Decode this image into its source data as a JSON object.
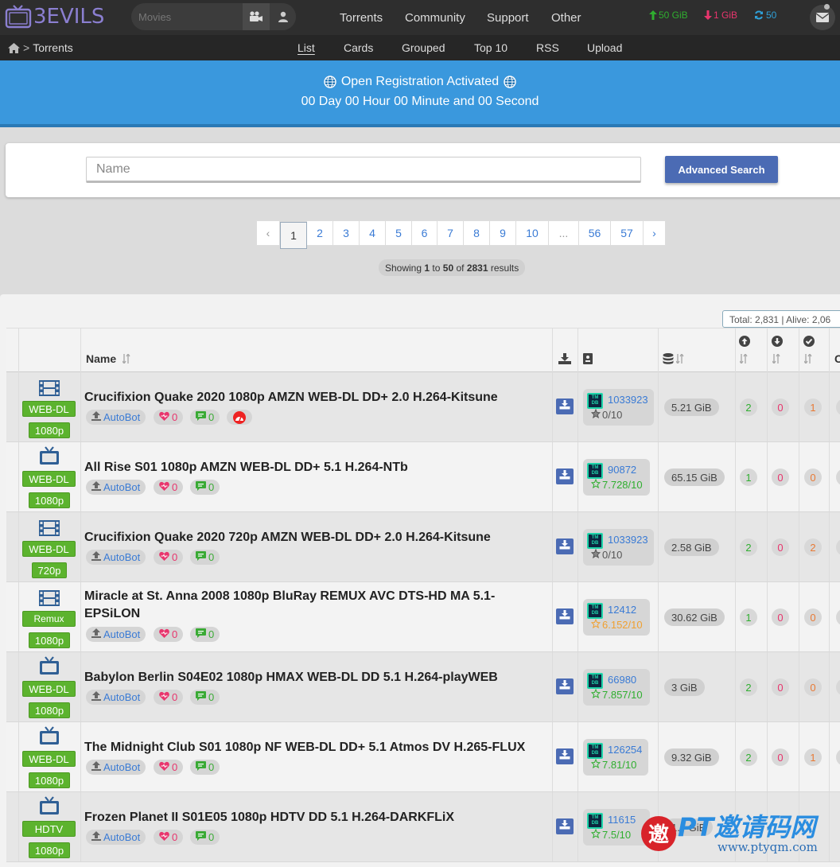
{
  "site": {
    "logo_text": "3EVILS"
  },
  "header": {
    "search_placeholder": "Movies",
    "nav": [
      "Torrents",
      "Community",
      "Support",
      "Other"
    ],
    "upload_stat": "50 GiB",
    "download_stat": "1 GiB",
    "ratio_stat": "50"
  },
  "subnav": {
    "breadcrumb": "Torrents",
    "items": [
      "List",
      "Cards",
      "Grouped",
      "Top 10",
      "RSS",
      "Upload"
    ],
    "active": "List"
  },
  "banner": {
    "line1": "Open Registration Activated",
    "line2": "00 Day 00 Hour 00 Minute and 00 Second"
  },
  "search": {
    "name_placeholder": "Name",
    "advanced_label": "Advanced Search"
  },
  "pagination": {
    "prev": "‹",
    "next": "›",
    "pages": [
      "1",
      "2",
      "3",
      "4",
      "5",
      "6",
      "7",
      "8",
      "9",
      "10",
      "...",
      "56",
      "57"
    ],
    "current": "1",
    "showing_prefix": "Showing",
    "from": "1",
    "to_word": "to",
    "to": "50",
    "of_word": "of",
    "total": "2831",
    "suffix": "results"
  },
  "summary": {
    "text": "Total: 2,831 | Alive: 2,06"
  },
  "table": {
    "name_header": "Name",
    "last_header": "C",
    "rows": [
      {
        "cat": "film",
        "type": "WEB-DL",
        "res": "1080p",
        "name": "Crucifixion Quake 2020 1080p AMZN WEB-DL DD+ 2.0 H.264-Kitsune",
        "uploader": "AutoBot",
        "thanks": "0",
        "comments": "0",
        "hot": true,
        "tmdb": "1033923",
        "rating": "0/10",
        "rating_color": "#555555",
        "size": "5.21 GiB",
        "seed": "2",
        "leech": "0",
        "done": "1"
      },
      {
        "cat": "tv",
        "type": "WEB-DL",
        "res": "1080p",
        "name": "All Rise S01 1080p AMZN WEB-DL DD+ 5.1 H.264-NTb",
        "uploader": "AutoBot",
        "thanks": "0",
        "comments": "0",
        "hot": false,
        "tmdb": "90872",
        "rating": "7.728/10",
        "rating_color": "#2fae2f",
        "size": "65.15 GiB",
        "seed": "1",
        "leech": "0",
        "done": "0"
      },
      {
        "cat": "film",
        "type": "WEB-DL",
        "res": "720p",
        "name": "Crucifixion Quake 2020 720p AMZN WEB-DL DD+ 2.0 H.264-Kitsune",
        "uploader": "AutoBot",
        "thanks": "0",
        "comments": "0",
        "hot": false,
        "tmdb": "1033923",
        "rating": "0/10",
        "rating_color": "#555555",
        "size": "2.58 GiB",
        "seed": "2",
        "leech": "0",
        "done": "2"
      },
      {
        "cat": "film",
        "type": "Remux",
        "res": "1080p",
        "name": "Miracle at St. Anna 2008 1080p BluRay REMUX AVC DTS-HD MA 5.1-EPSiLON",
        "uploader": "AutoBot",
        "thanks": "0",
        "comments": "0",
        "hot": false,
        "tmdb": "12412",
        "rating": "6.152/10",
        "rating_color": "#f0a030",
        "size": "30.62 GiB",
        "seed": "1",
        "leech": "0",
        "done": "0"
      },
      {
        "cat": "tv",
        "type": "WEB-DL",
        "res": "1080p",
        "name": "Babylon Berlin S04E02 1080p HMAX WEB-DL DD 5.1 H.264-playWEB",
        "uploader": "AutoBot",
        "thanks": "0",
        "comments": "0",
        "hot": false,
        "tmdb": "66980",
        "rating": "7.857/10",
        "rating_color": "#2fae2f",
        "size": "3 GiB",
        "seed": "2",
        "leech": "0",
        "done": "0"
      },
      {
        "cat": "tv",
        "type": "WEB-DL",
        "res": "1080p",
        "name": "The Midnight Club S01 1080p NF WEB-DL DD+ 5.1 Atmos DV H.265-FLUX",
        "uploader": "AutoBot",
        "thanks": "0",
        "comments": "0",
        "hot": false,
        "tmdb": "126254",
        "rating": "7.81/10",
        "rating_color": "#2fae2f",
        "size": "9.32 GiB",
        "seed": "2",
        "leech": "0",
        "done": "1"
      },
      {
        "cat": "tv",
        "type": "HDTV",
        "res": "1080p",
        "name": "Frozen Planet II S01E05 1080p HDTV DD 5.1 H.264-DARKFLiX",
        "uploader": "AutoBot",
        "thanks": "0",
        "comments": "0",
        "hot": false,
        "tmdb": "11615",
        "rating": "7.5/10",
        "rating_color": "#2fae2f",
        "size": "1.7 GiB",
        "seed": "",
        "leech": "",
        "done": ""
      }
    ]
  },
  "watermark": {
    "title": "PT邀请码网",
    "url": "www.ptyqm.com"
  },
  "colors": {
    "accent": "#3a98dd",
    "tag_green": "#5cb32e",
    "link_blue": "#3a7bd5",
    "button_blue": "#4b6bb4",
    "upload_green": "#2fae2f",
    "download_red": "#e8356d"
  }
}
